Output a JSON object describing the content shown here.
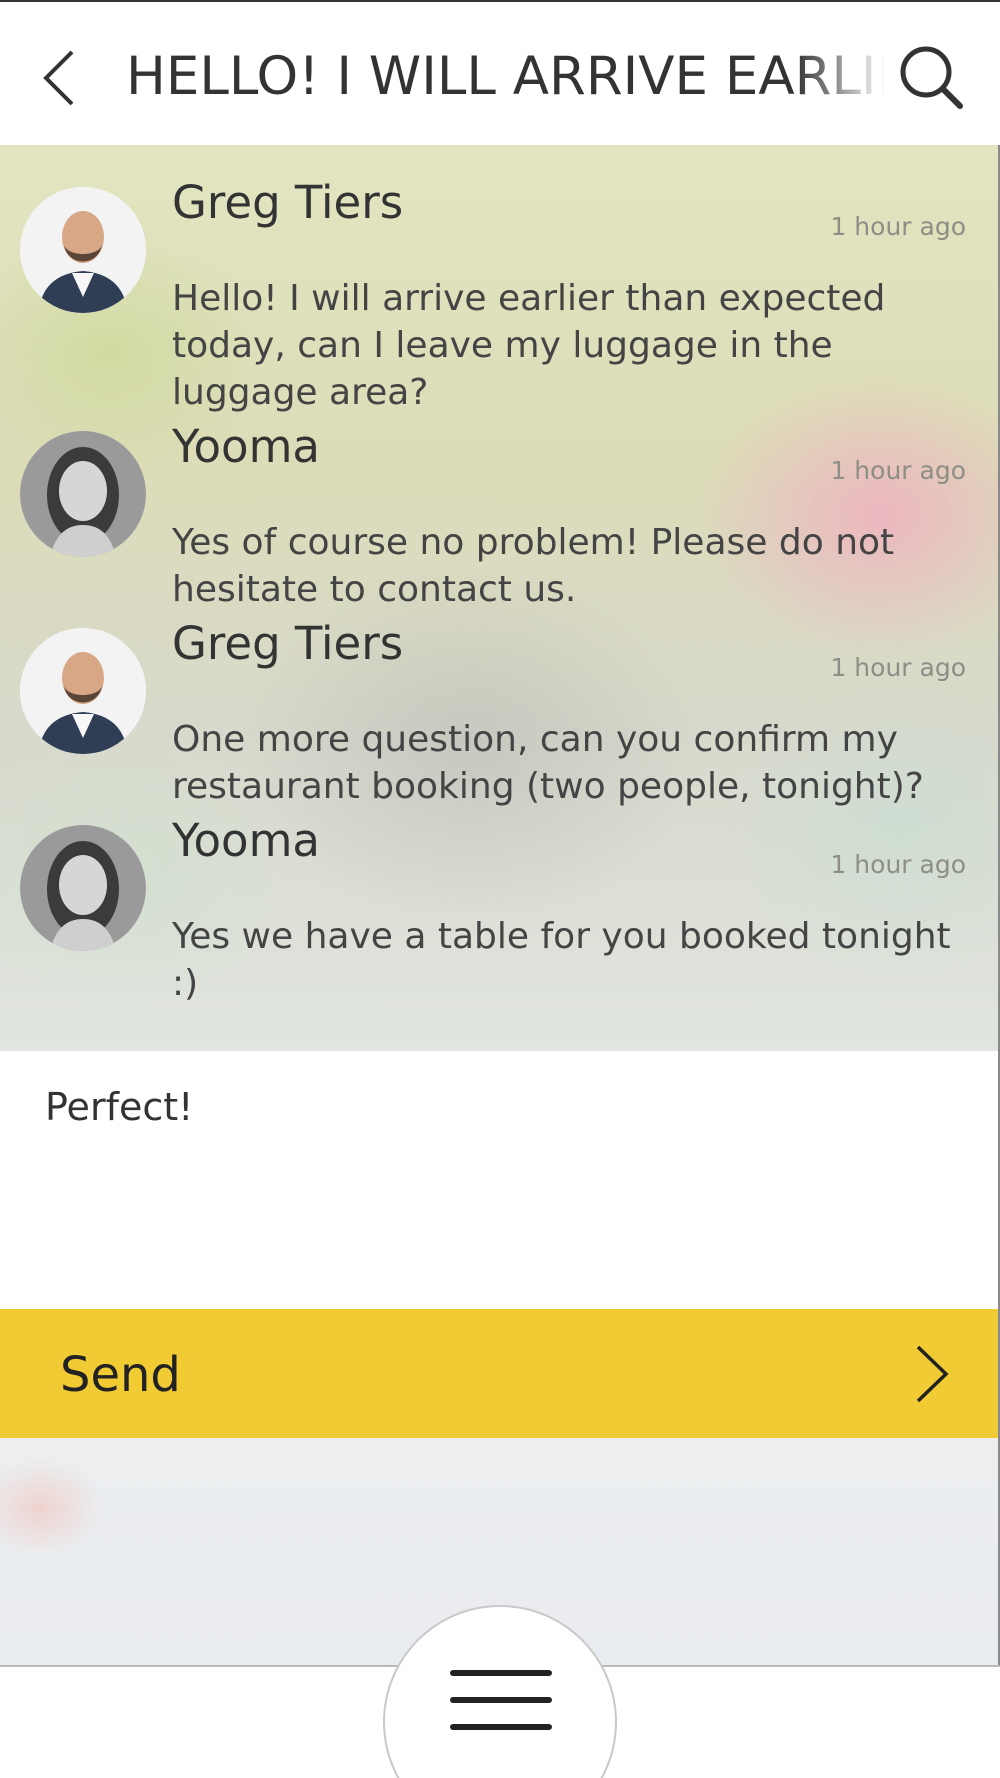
{
  "header": {
    "title": "HELLO! I WILL ARRIVE EARLIER THAN EXPECTED TODAY, CAN I LEAVE MY LUGGAGE IN THE LUGGAGE AREA?",
    "back_icon": "chevron-left-icon",
    "search_icon": "search-icon"
  },
  "messages": [
    {
      "author": "Greg Tiers",
      "time": "1 hour ago",
      "text": "Hello! I will arrive earlier than expected today, can I leave my luggage in the luggage area?",
      "avatar": "man-avatar"
    },
    {
      "author": "Yooma",
      "time": "1 hour ago",
      "text": "Yes of course no problem! Please do not hesitate to contact us.",
      "avatar": "woman-avatar"
    },
    {
      "author": "Greg Tiers",
      "time": "1 hour ago",
      "text": "One more question, can you confirm my restaurant booking (two people, tonight)?",
      "avatar": "man-avatar"
    },
    {
      "author": "Yooma",
      "time": "1 hour ago",
      "text": "Yes we have a table for you booked tonight :)",
      "avatar": "woman-avatar"
    }
  ],
  "compose": {
    "value": "Perfect!"
  },
  "send": {
    "label": "Send",
    "icon": "chevron-right-icon"
  },
  "menu": {
    "icon": "hamburger-menu-icon"
  },
  "colors": {
    "accent": "#f1cb33",
    "text": "#333333",
    "timestamp": "#8e8e86"
  }
}
